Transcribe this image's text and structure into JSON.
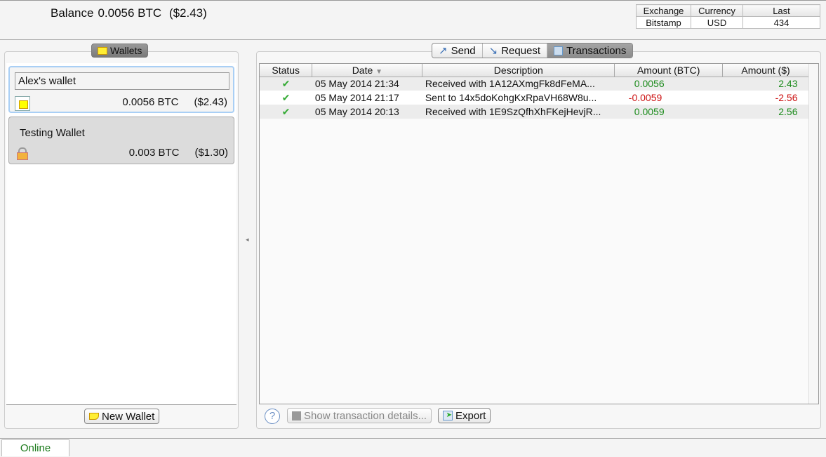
{
  "header": {
    "balance_label": "Balance",
    "balance_btc": "0.0056 BTC",
    "balance_fiat": "($2.43)"
  },
  "ticker": {
    "headers": [
      "Exchange",
      "Currency",
      "Last"
    ],
    "values": [
      "Bitstamp",
      "USD",
      "434"
    ]
  },
  "wallets": {
    "tab_label": "Wallets",
    "items": [
      {
        "name": "Alex's wallet",
        "btc": "0.0056 BTC",
        "fiat": "($2.43)"
      },
      {
        "name": "Testing Wallet",
        "btc": "0.003 BTC",
        "fiat": "($1.30)"
      }
    ],
    "new_wallet": "New Wallet"
  },
  "tabs": {
    "send": "Send",
    "request": "Request",
    "transactions": "Transactions"
  },
  "table": {
    "headers": [
      "Status",
      "Date",
      "Description",
      "Amount (BTC)",
      "Amount ($)"
    ],
    "rows": [
      {
        "date": "05 May 2014 21:34",
        "desc": "Received with 1A12AXmgFk8dFeMA...",
        "btc": "0.0056",
        "usd": "2.43"
      },
      {
        "date": "05 May 2014 21:17",
        "desc": "Sent to 14x5doKohgKxRpaVH68W8u...",
        "btc": "-0.0059",
        "usd": "-2.56"
      },
      {
        "date": "05 May 2014 20:13",
        "desc": "Received with 1E9SzQfhXhFKejHevjR...",
        "btc": "0.0059",
        "usd": "2.56"
      }
    ]
  },
  "footer": {
    "help": "?",
    "details": "Show transaction details...",
    "export": "Export"
  },
  "status": {
    "online": "Online"
  },
  "colors": {
    "positive": "#1a8a1a",
    "negative": "#cc1111"
  }
}
